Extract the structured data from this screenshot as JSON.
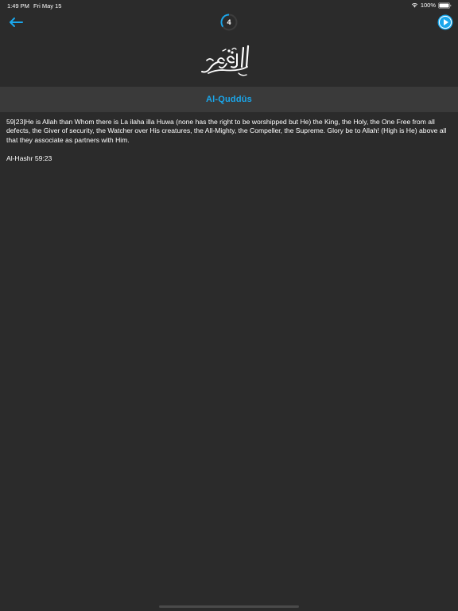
{
  "status_bar": {
    "time": "1:49 PM",
    "date": "Fri May 15",
    "battery": "100%"
  },
  "nav": {
    "back_icon": "arrow-left-icon",
    "progress_number": "4",
    "play_icon": "play-circle-icon"
  },
  "calligraphy": {
    "icon": "arabic-calligraphy-al-quddus"
  },
  "title": "Al-Quddūs",
  "content": {
    "verse": "59|23|He is Allah than Whom there is La ilaha illa Huwa (none has the right to be worshipped but He) the King, the Holy, the One Free from all defects, the Giver of security, the Watcher over His creatures, the All-Mighty, the Compeller, the Supreme. Glory be to Allah! (High is He) above all that they associate as partners with Him.",
    "reference": "Al-Hashr 59:23"
  },
  "colors": {
    "background": "#2b2b2b",
    "title_band": "#3a3a3a",
    "accent": "#1aa7ec"
  }
}
